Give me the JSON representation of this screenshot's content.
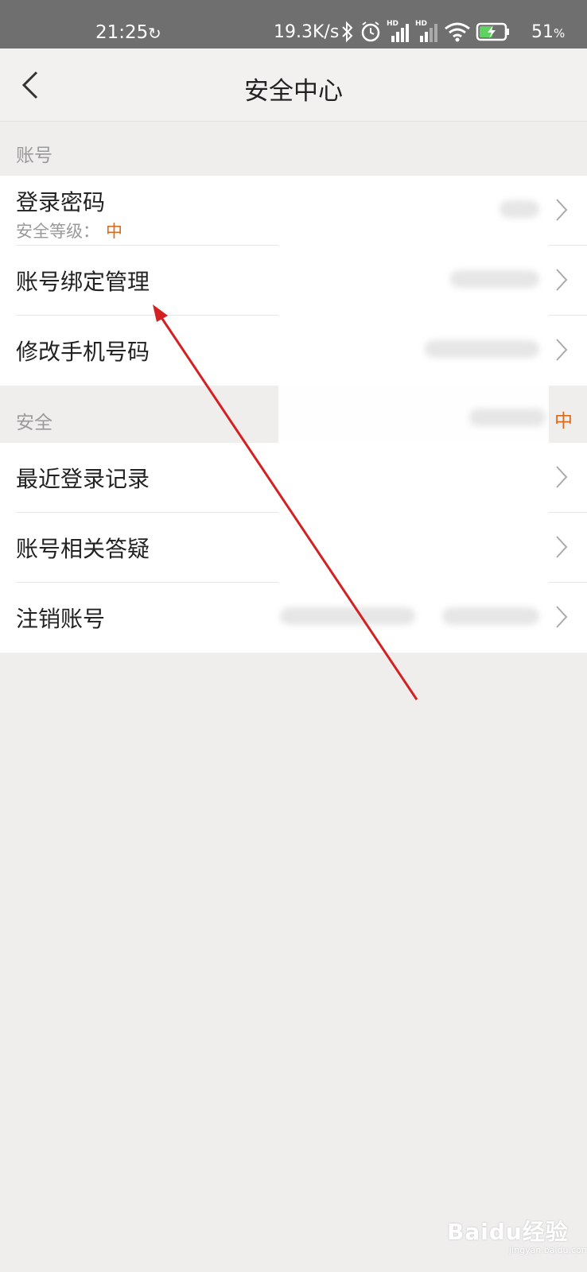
{
  "status_bar": {
    "time": "21:25",
    "network_speed": "19.3K/s",
    "battery_percent": "51",
    "battery_unit": "%",
    "icons": [
      "refresh-icon",
      "bluetooth-icon",
      "alarm-icon",
      "signal-hd-icon",
      "signal-hd-icon",
      "wifi-icon",
      "battery-charging-icon"
    ]
  },
  "header": {
    "back_icon": "chevron-left-icon",
    "title": "安全中心"
  },
  "sections": {
    "account": {
      "label": "账号",
      "items": [
        {
          "title": "登录密码",
          "subtitle_prefix": "安全等级：",
          "subtitle_level": "中"
        },
        {
          "title": "账号绑定管理"
        },
        {
          "title": "修改手机号码"
        }
      ]
    },
    "security": {
      "label": "安全",
      "right_value": "中",
      "items": [
        {
          "title": "最近登录记录"
        },
        {
          "title": "账号相关答疑"
        },
        {
          "title": "注销账号"
        }
      ]
    }
  },
  "colors": {
    "accent": "#d96a1a",
    "background": "#efeeed",
    "annotation_arrow": "#d42020"
  },
  "watermark": {
    "text": "Baidu经验",
    "sub": "jingyan.baidu.com"
  }
}
